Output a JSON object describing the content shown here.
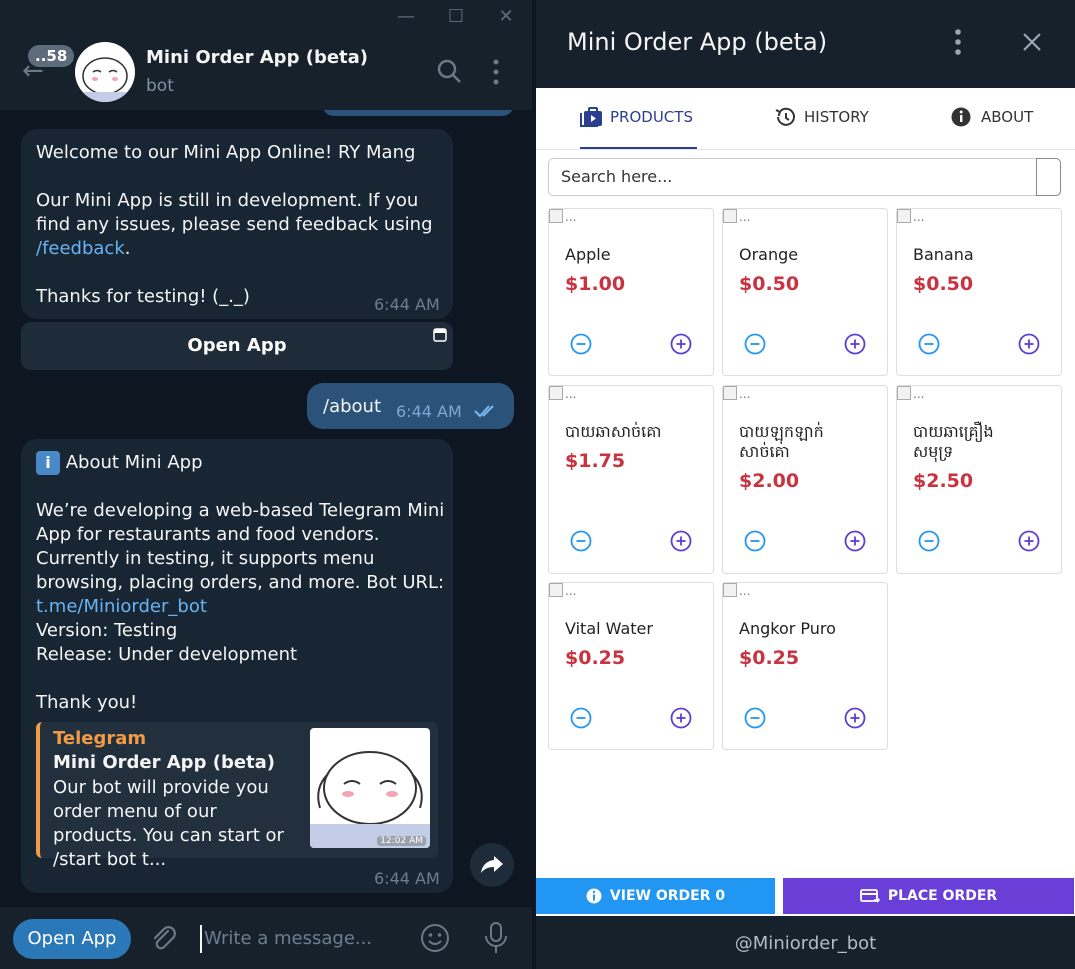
{
  "window": {
    "minimize": "—",
    "maximize": "☐",
    "close": "✕"
  },
  "chat": {
    "unread_count": "..58",
    "name": "Mini Order App (beta)",
    "subtitle": "bot"
  },
  "messages": {
    "welcome": {
      "line1": "Welcome to our Mini App Online! RY Mang",
      "line2": "Our Mini App is still in development. If you find any issues, please send feedback using",
      "feedback_link": "/feedback",
      "line3": "Thanks for testing! (_._)",
      "time": "6:44 AM",
      "button_label": "Open App"
    },
    "outgoing": {
      "text": "/about",
      "time": "6:44 AM"
    },
    "about": {
      "heading": "About Mini App",
      "body": "We’re developing a web-based Telegram Mini App for restaurants and food vendors. Currently in testing, it supports menu browsing, placing orders, and more. Bot URL:",
      "bot_link": "t.me/Miniorder_bot",
      "version": "Version: Testing",
      "release": "Release: Under development",
      "thanks": "Thank you!",
      "time": "6:44 AM",
      "preview": {
        "site": "Telegram",
        "title": "Mini Order App (beta)",
        "desc": "Our bot will provide you order menu of our products. You can start or /start bot t...",
        "img_time": "12:02 AM"
      }
    }
  },
  "composer": {
    "open_app": "Open App",
    "placeholder": "Write a message..."
  },
  "miniapp": {
    "title": "Mini Order App (beta)",
    "tabs": [
      {
        "label": "PRODUCTS",
        "icon": "bag-icon",
        "active": true
      },
      {
        "label": "HISTORY",
        "icon": "history-icon"
      },
      {
        "label": "ABOUT",
        "icon": "info-icon"
      }
    ],
    "search_placeholder": "Search here...",
    "image_alt": "...",
    "products": [
      {
        "name": "Apple",
        "price": "$1.00"
      },
      {
        "name": "Orange",
        "price": "$0.50"
      },
      {
        "name": "Banana",
        "price": "$0.50"
      },
      {
        "name": "បាយឆាសាច់គោ",
        "price": "$1.75"
      },
      {
        "name": "បាយឡុកឡាក់សាច់គោ",
        "price": "$2.00"
      },
      {
        "name": "បាយឆាគ្រឿងសមុទ្រ",
        "price": "$2.50"
      },
      {
        "name": "Vital Water",
        "price": "$0.25"
      },
      {
        "name": "Angkor Puro",
        "price": "$0.25"
      }
    ],
    "view_order": "VIEW ORDER 0",
    "place_order": "PLACE ORDER",
    "footer": "@Miniorder_bot"
  },
  "colors": {
    "accent": "#2196f3",
    "purple": "#6a3fd8",
    "price": "#c8333f",
    "chat_bg": "#0e1621"
  }
}
